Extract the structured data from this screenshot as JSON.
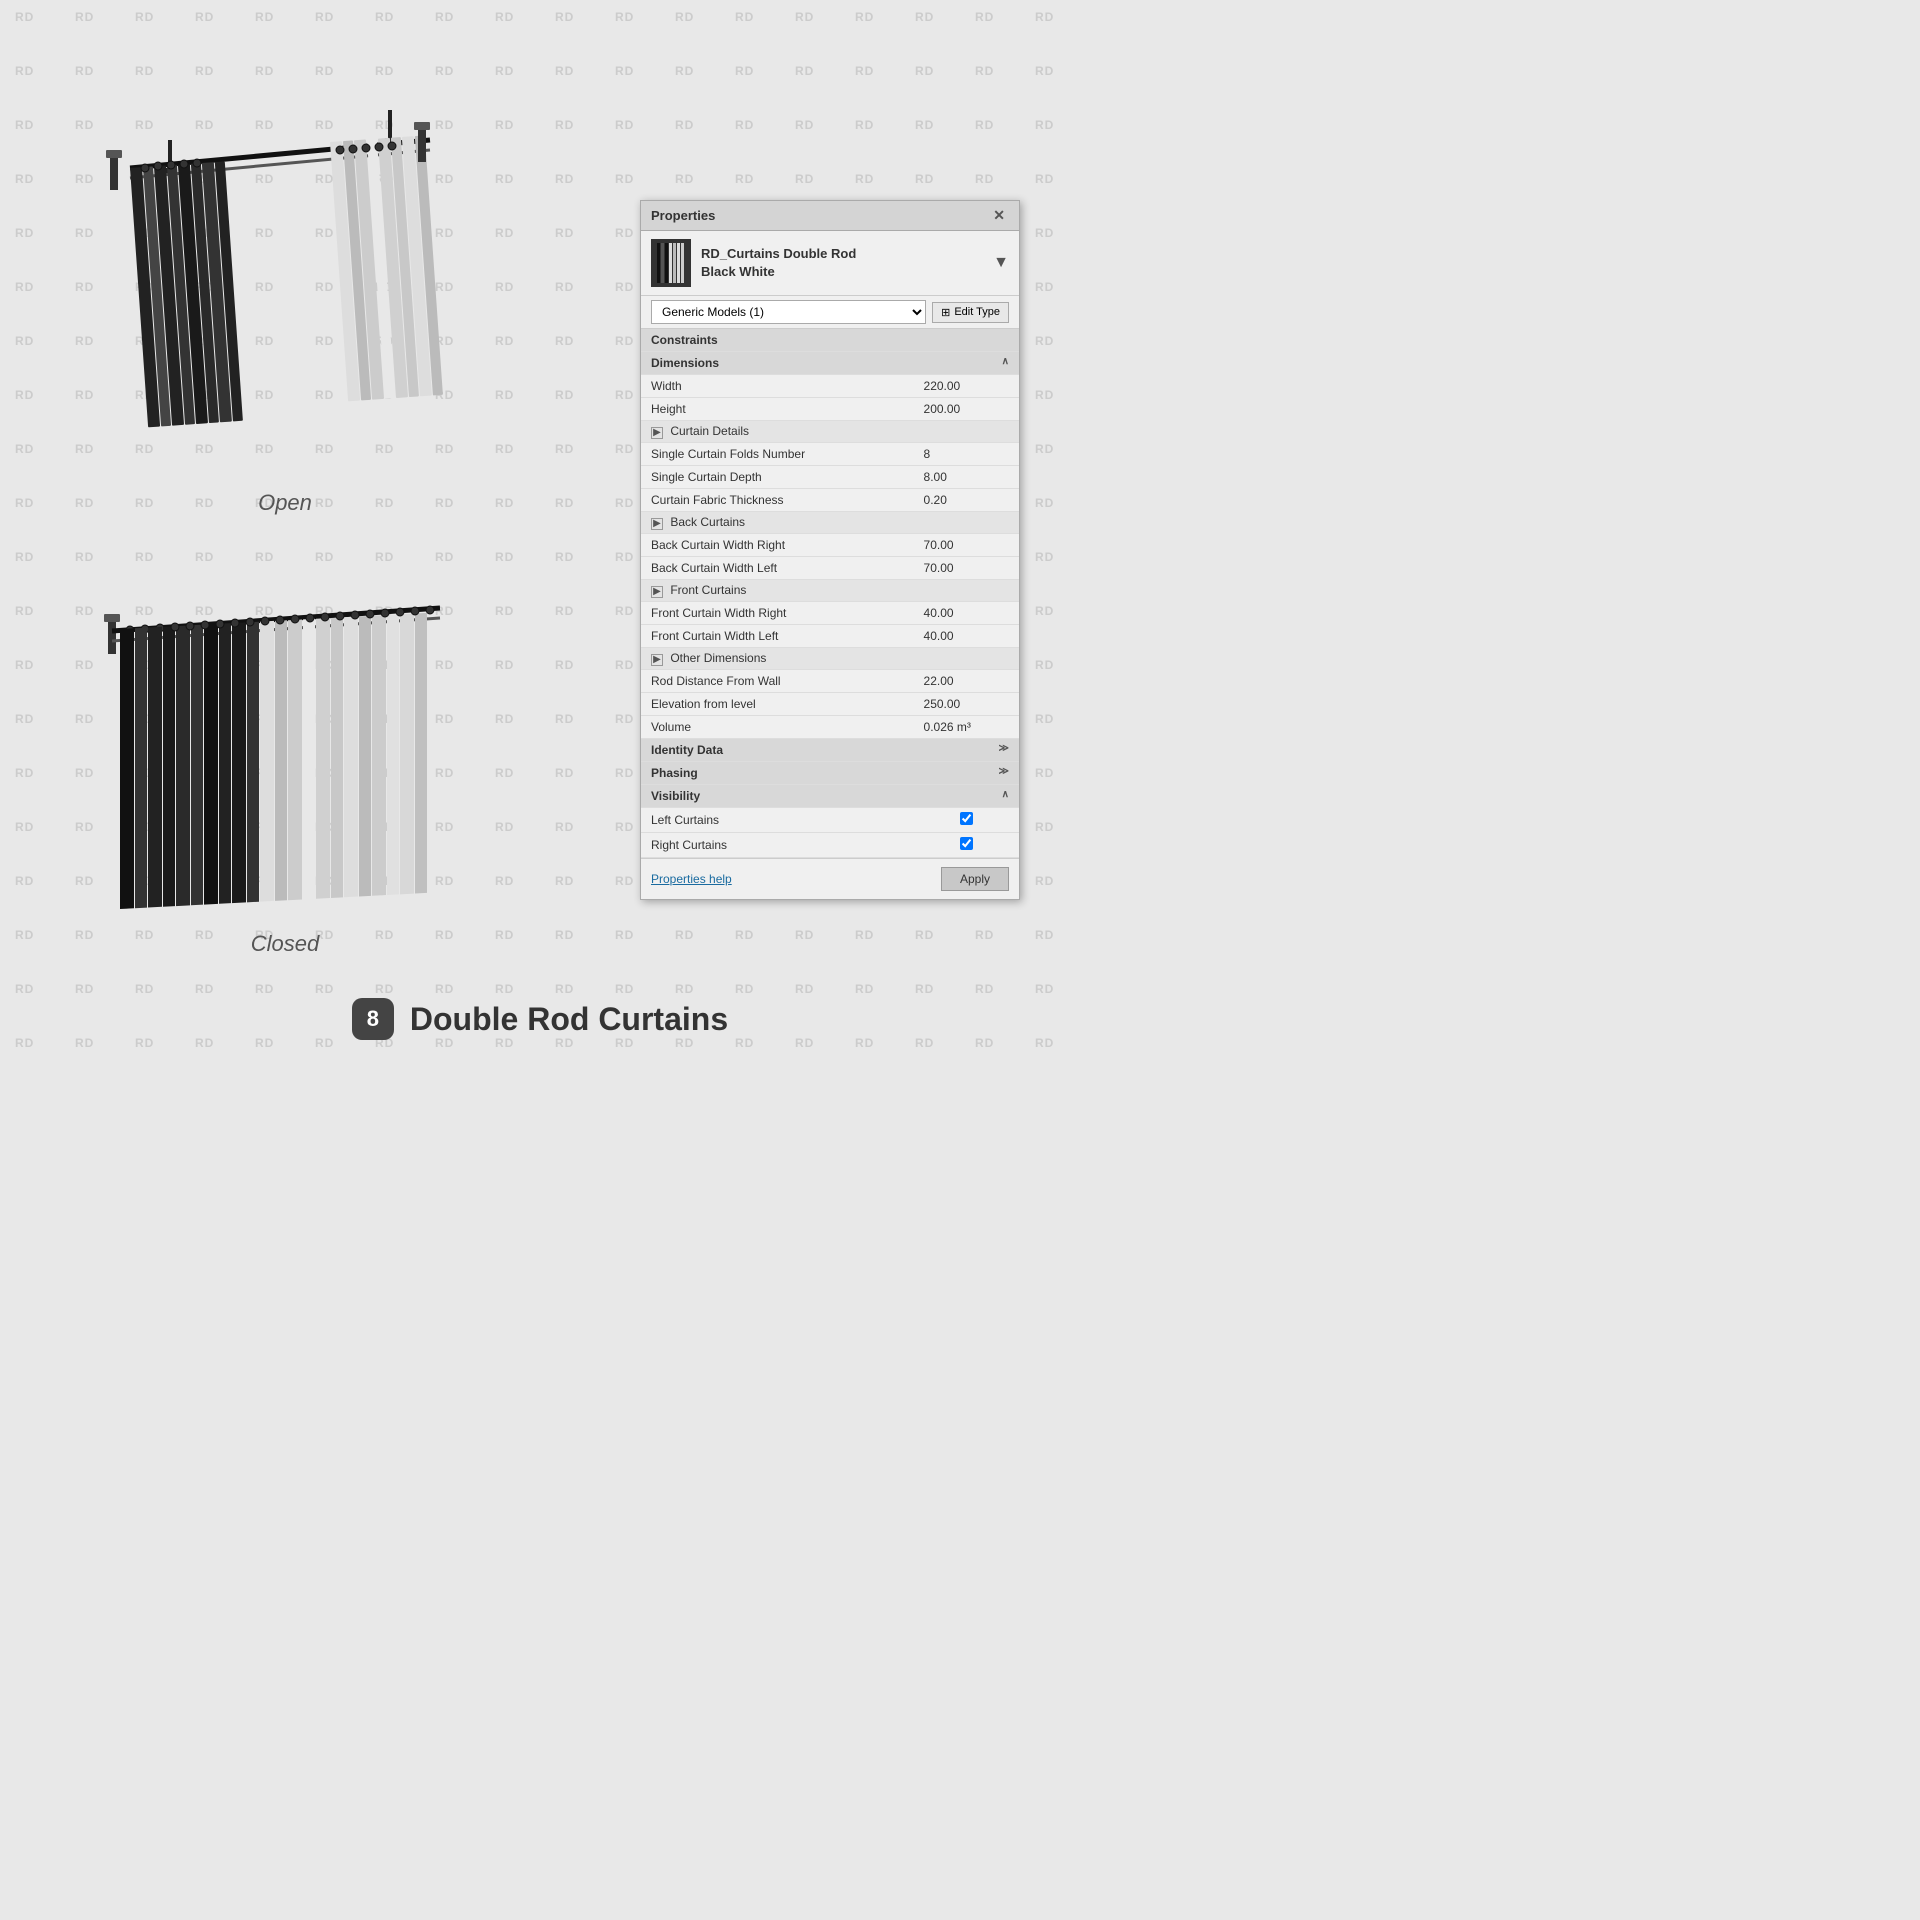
{
  "watermark": {
    "text": "RD",
    "rows": 20,
    "cols": 18
  },
  "panel": {
    "title": "Properties",
    "close_label": "✕",
    "component_name": "RD_Curtains Double Rod",
    "component_subname": "Black White",
    "dropdown_value": "Generic Models (1)",
    "edit_type_label": "Edit Type",
    "sections": {
      "constraints": "Constraints",
      "dimensions": "Dimensions",
      "curtain_details": "Curtain Details",
      "back_curtains": "Back Curtains",
      "front_curtains": "Front Curtains",
      "other_dimensions": "Other Dimensions",
      "identity_data": "Identity Data",
      "phasing": "Phasing",
      "visibility": "Visibility"
    },
    "properties": [
      {
        "label": "Width",
        "value": "220.00",
        "section": "dimensions"
      },
      {
        "label": "Height",
        "value": "200.00",
        "section": "dimensions"
      },
      {
        "label": "Single Curtain Folds Number",
        "value": "8",
        "section": "curtain_details"
      },
      {
        "label": "Single Curtain Depth",
        "value": "8.00",
        "section": "curtain_details"
      },
      {
        "label": "Curtain Fabric Thickness",
        "value": "0.20",
        "section": "curtain_details"
      },
      {
        "label": "Back Curtain Width Right",
        "value": "70.00",
        "section": "back_curtains"
      },
      {
        "label": "Back Curtain Width Left",
        "value": "70.00",
        "section": "back_curtains"
      },
      {
        "label": "Front Curtain Width Right",
        "value": "40.00",
        "section": "front_curtains"
      },
      {
        "label": "Front Curtain Width Left",
        "value": "40.00",
        "section": "front_curtains"
      },
      {
        "label": "Rod Distance From Wall",
        "value": "22.00",
        "section": "other_dimensions"
      },
      {
        "label": "Elevation from level",
        "value": "250.00",
        "section": "other_dimensions"
      },
      {
        "label": "Volume",
        "value": "0.026 m³",
        "section": "other_dimensions"
      }
    ],
    "visibility": [
      {
        "label": "Left Curtains",
        "checked": true
      },
      {
        "label": "Right Curtains",
        "checked": true
      }
    ],
    "footer": {
      "help_link": "Properties help",
      "apply_button": "Apply"
    }
  },
  "illustrations": {
    "open_label": "Open",
    "closed_label": "Closed"
  },
  "bottom": {
    "number": "8",
    "title": "Double Rod Curtains"
  }
}
